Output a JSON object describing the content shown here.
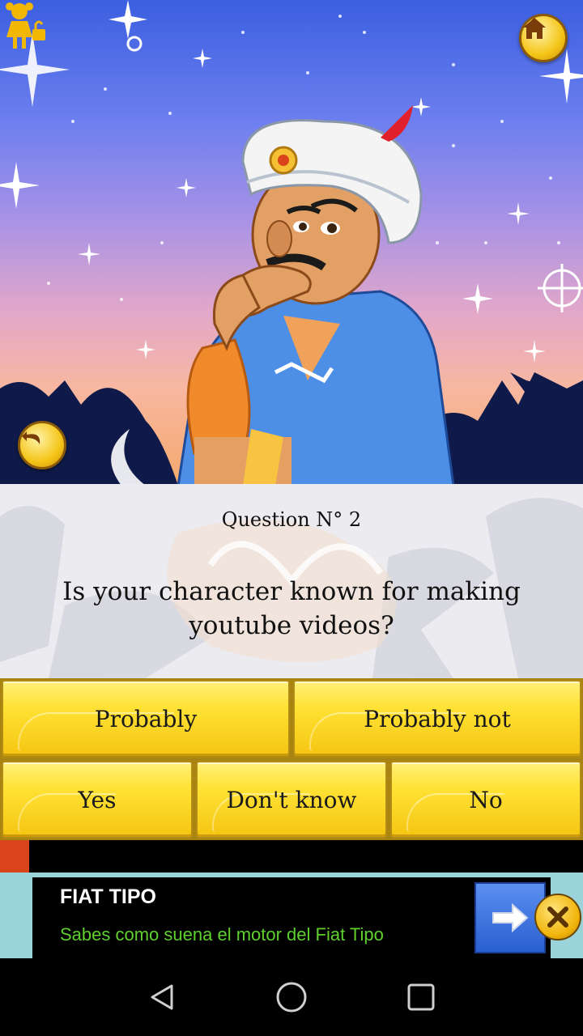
{
  "scene": {
    "character": "genie-character",
    "icons": {
      "home": "home-icon",
      "profile": "girl-profile-lock-icon",
      "back": "undo-arrow-icon"
    }
  },
  "question": {
    "number_label": "Question N° 2",
    "text": "Is your character known for making youtube videos?"
  },
  "answers": {
    "probably": "Probably",
    "probably_not": "Probably not",
    "yes": "Yes",
    "dont_know": "Don't know",
    "no": "No"
  },
  "ad": {
    "title": "FIAT TIPO",
    "subtitle": "Sabes como suena el motor del Fiat Tipo",
    "arrow_icon": "arrow-right-icon",
    "close_icon": "close-x-icon"
  },
  "navbar": {
    "back_icon": "triangle-back-icon",
    "home_icon": "circle-home-icon",
    "recents_icon": "square-recents-icon"
  },
  "colors": {
    "button_yellow": "#ffe234",
    "ad_green": "#5fd02e",
    "panel_bg": "#ecebf0"
  }
}
